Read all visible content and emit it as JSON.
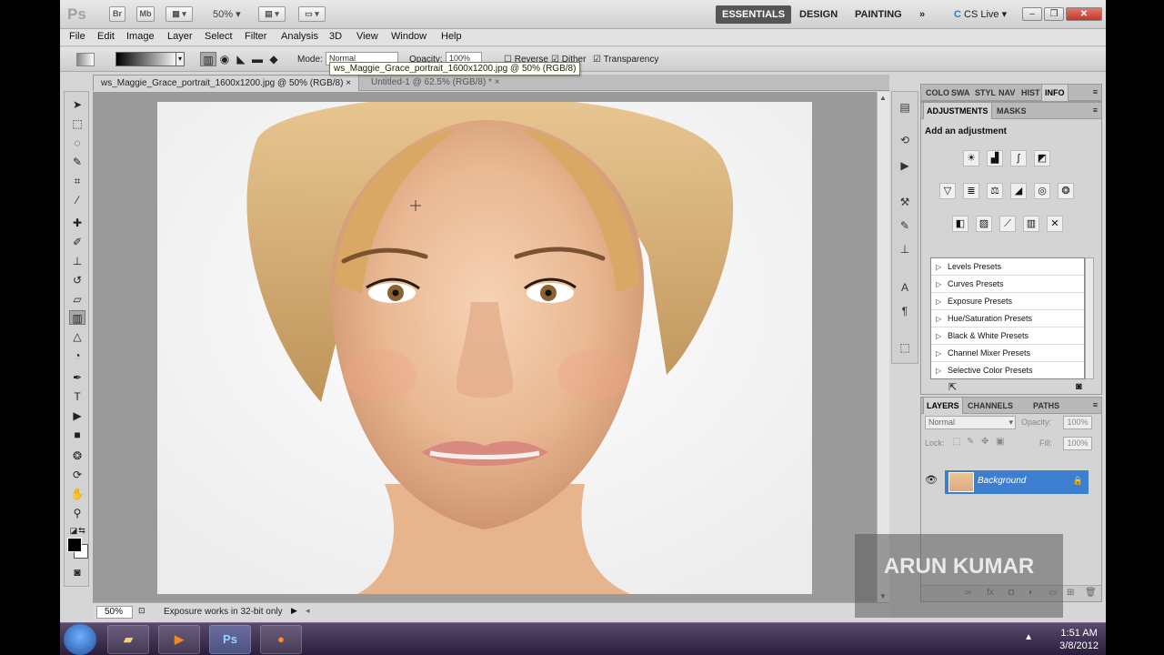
{
  "app": {
    "logo": "Ps",
    "bridge_label": "Br",
    "minibridge_label": "Mb",
    "zoom_level": "50%",
    "workspaces": [
      "ESSENTIALS",
      "DESIGN",
      "PAINTING"
    ],
    "more_workspaces": "»",
    "cs_live": "CS Live",
    "minimize": "–",
    "restore": "❐",
    "close": "✕"
  },
  "menu": [
    "File",
    "Edit",
    "Image",
    "Layer",
    "Select",
    "Filter",
    "Analysis",
    "3D",
    "View",
    "Window",
    "Help"
  ],
  "options": {
    "mode_label": "Mode:",
    "mode_value": "Normal",
    "opacity_label": "Opacity:",
    "opacity_value": "100%",
    "reverse_label": "Reverse",
    "dither_label": "Dither",
    "transparency_label": "Transparency",
    "tooltip": "ws_Maggie_Grace_portrait_1600x1200.jpg @ 50% (RGB/8)"
  },
  "tabs": [
    {
      "label": "ws_Maggie_Grace_portrait_1600x1200.jpg @ 50% (RGB/8)",
      "close": "×",
      "active": true
    },
    {
      "label": "Untitled-1 @ 62.5% (RGB/8) *",
      "close": "×",
      "active": false
    }
  ],
  "status": {
    "zoom": "50%",
    "message": "Exposure works in 32-bit only",
    "arrow": "▶"
  },
  "panel_top": {
    "tabs": [
      "COLO",
      "SWA",
      "STYL",
      "NAV",
      "HIST",
      "INFO"
    ]
  },
  "adjustments": {
    "tabs": [
      "ADJUSTMENTS",
      "MASKS"
    ],
    "title": "Add an adjustment",
    "presets": [
      "Levels Presets",
      "Curves Presets",
      "Exposure Presets",
      "Hue/Saturation Presets",
      "Black & White Presets",
      "Channel Mixer Presets",
      "Selective Color Presets"
    ]
  },
  "layers": {
    "tabs": [
      "LAYERS",
      "CHANNELS",
      "PATHS"
    ],
    "blend_mode": "Normal",
    "opacity_label": "Opacity:",
    "opacity_value": "100%",
    "lock_label": "Lock:",
    "fill_label": "Fill:",
    "fill_value": "100%",
    "layer_name": "Background"
  },
  "watermark": "ARUN KUMAR",
  "taskbar": {
    "ps_label": "Ps",
    "time": "1:51 AM",
    "date": "3/8/2012"
  },
  "colors": {
    "selection_blue": "#3c7fd1",
    "workspace_active": "#555555",
    "close_red": "#c0392b"
  }
}
